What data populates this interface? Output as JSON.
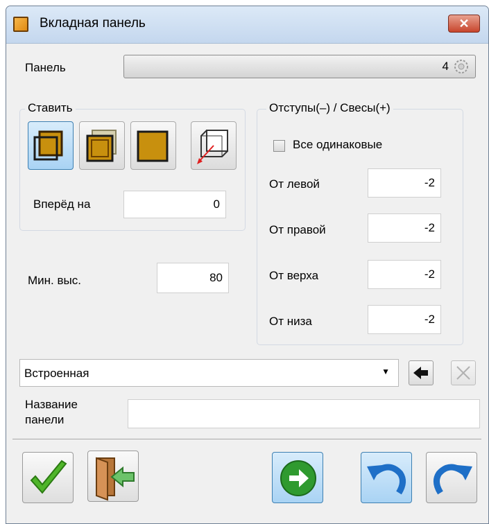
{
  "window": {
    "title": "Вкладная панель",
    "close_label": "✕"
  },
  "panel": {
    "label": "Панель",
    "value": "4"
  },
  "stavit": {
    "title": "Ставить",
    "forward_label": "Вперёд на",
    "forward_value": "0"
  },
  "min_height": {
    "label": "Мин. выс.",
    "value": "80"
  },
  "offsets": {
    "title": "Отступы(–) / Свесы(+)",
    "all_same_label": "Все одинаковые",
    "all_same_checked": false,
    "rows": [
      {
        "label": "От левой",
        "value": "-2"
      },
      {
        "label": "От правой",
        "value": "-2"
      },
      {
        "label": "От верха",
        "value": "-2"
      },
      {
        "label": "От низа",
        "value": "-2"
      }
    ]
  },
  "preset": {
    "selected": "Встроенная"
  },
  "name": {
    "label_line1": "Название",
    "label_line2": "панели",
    "value": ""
  }
}
